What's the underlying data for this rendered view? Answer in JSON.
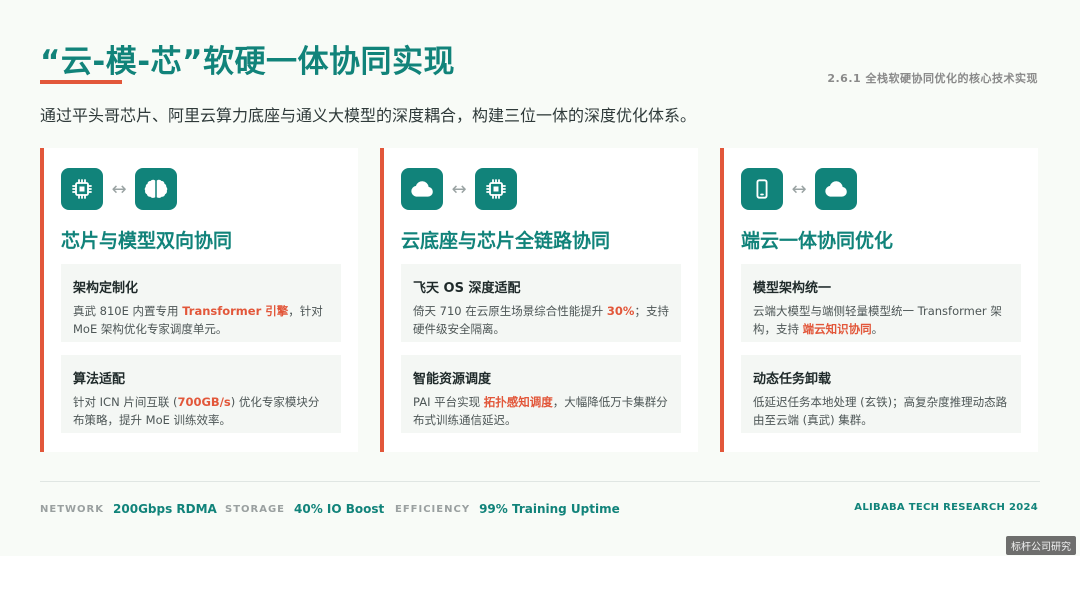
{
  "header": {
    "title": "“云-模-芯”软硬一体协同实现",
    "section": "2.6.1 全栈软硬协同优化的核心技术实现",
    "subtitle": "通过平头哥芯片、阿里云算力底座与通义大模型的深度耦合，构建三位一体的深度优化体系。"
  },
  "colors": {
    "primary": "#11837a",
    "accent": "#e2573a",
    "background": "#f8fbf7"
  },
  "arrow_glyph": "↔",
  "cards": [
    {
      "icons": [
        "chip-icon",
        "brain-icon"
      ],
      "title": "芯片与模型双向协同",
      "blocks": [
        {
          "title": "架构定制化",
          "pre": "真武 810E 内置专用 ",
          "hl": "Transformer 引擎",
          "post": "，针对 MoE 架构优化专家调度单元。"
        },
        {
          "title": "算法适配",
          "pre": "针对 ICN 片间互联 (",
          "hl": "700GB/s",
          "post": ") 优化专家模块分布策略，提升 MoE 训练效率。"
        }
      ]
    },
    {
      "icons": [
        "cloud-icon",
        "chip-icon"
      ],
      "title": "云底座与芯片全链路协同",
      "blocks": [
        {
          "title": "飞天 OS 深度适配",
          "pre": "倚天 710 在云原生场景综合性能提升 ",
          "hl": "30%",
          "post": "；支持硬件级安全隔离。"
        },
        {
          "title": "智能资源调度",
          "pre": "PAI 平台实现 ",
          "hl": "拓扑感知调度",
          "post": "，大幅降低万卡集群分布式训练通信延迟。"
        }
      ]
    },
    {
      "icons": [
        "smartphone-icon",
        "cloud-icon"
      ],
      "title": "端云一体协同优化",
      "blocks": [
        {
          "title": "模型架构统一",
          "pre": "云端大模型与端侧轻量模型统一 Transformer 架构，支持 ",
          "hl": "端云知识协同",
          "post": "。"
        },
        {
          "title": "动态任务卸载",
          "pre": "低延迟任务本地处理 (玄铁)；高复杂度推理动态路由至云端 (真武) 集群。",
          "hl": "",
          "post": ""
        }
      ]
    }
  ],
  "footer": {
    "stats": [
      {
        "key": "NETWORK",
        "value": "200Gbps RDMA"
      },
      {
        "key": "STORAGE",
        "value": "40% IO Boost"
      },
      {
        "key": "EFFICIENCY",
        "value": "99% Training Uptime"
      }
    ],
    "brand": "ALIBABA TECH RESEARCH 2024"
  },
  "watermark": "标杆公司研究"
}
